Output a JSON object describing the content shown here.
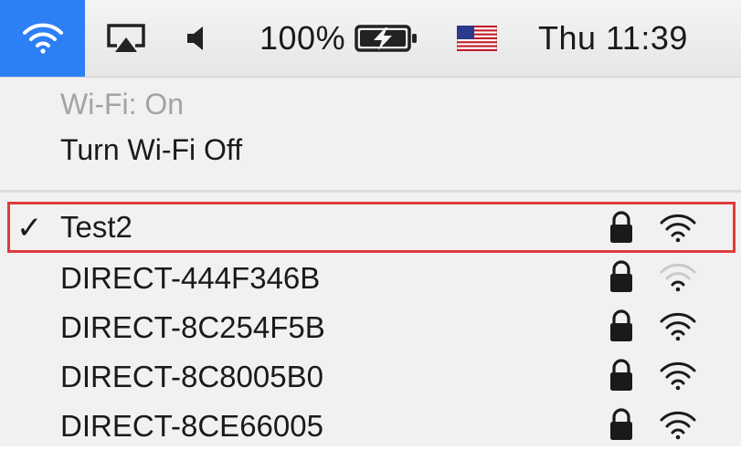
{
  "menubar": {
    "battery_percent": "100%",
    "clock": "Thu 11:39",
    "icons": [
      "wifi-icon",
      "airplay-icon",
      "volume-icon",
      "battery-charging-icon",
      "us-flag-icon"
    ]
  },
  "menu": {
    "status": "Wi-Fi: On",
    "toggle_label": "Turn Wi-Fi Off",
    "networks": [
      {
        "name": "Test2",
        "connected": true,
        "secured": true,
        "signal": "full"
      },
      {
        "name": "DIRECT-444F346B",
        "connected": false,
        "secured": true,
        "signal": "weak"
      },
      {
        "name": "DIRECT-8C254F5B",
        "connected": false,
        "secured": true,
        "signal": "full"
      },
      {
        "name": "DIRECT-8C8005B0",
        "connected": false,
        "secured": true,
        "signal": "full"
      },
      {
        "name": "DIRECT-8CE66005",
        "connected": false,
        "secured": true,
        "signal": "full"
      }
    ],
    "check_glyph": "✓"
  },
  "colors": {
    "wifi_highlight": "#2d7ff6",
    "selection_outline": "#e03b3b",
    "disabled_text": "#a3a3a3"
  }
}
